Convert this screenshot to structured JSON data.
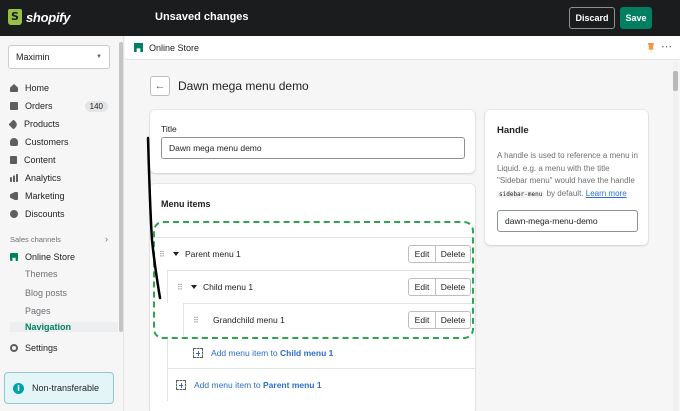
{
  "topbar": {
    "brand": "shopify",
    "status": "Unsaved changes",
    "discard_label": "Discard",
    "save_label": "Save"
  },
  "sidebar": {
    "store_name": "Maximin",
    "items": [
      {
        "label": "Home",
        "icon": "home-icon"
      },
      {
        "label": "Orders",
        "icon": "orders-icon",
        "badge": "140"
      },
      {
        "label": "Products",
        "icon": "tag-icon"
      },
      {
        "label": "Customers",
        "icon": "person-icon"
      },
      {
        "label": "Content",
        "icon": "content-icon"
      },
      {
        "label": "Analytics",
        "icon": "analytics-icon"
      },
      {
        "label": "Marketing",
        "icon": "megaphone-icon"
      },
      {
        "label": "Discounts",
        "icon": "discount-icon"
      }
    ],
    "sales_channels_label": "Sales channels",
    "online_store": "Online Store",
    "sub_items": [
      "Themes",
      "Blog posts",
      "Pages",
      "Navigation"
    ],
    "settings": "Settings",
    "non_transferable": "Non-transferable"
  },
  "app_bar": {
    "title": "Online Store"
  },
  "page": {
    "title": "Dawn mega menu demo"
  },
  "title_card": {
    "label": "Title",
    "value": "Dawn mega menu demo"
  },
  "menu_card": {
    "heading": "Menu items",
    "items": [
      {
        "label": "Parent menu 1"
      },
      {
        "label": "Child menu 1"
      },
      {
        "label": "Grandchild menu 1"
      }
    ],
    "edit_label": "Edit",
    "delete_label": "Delete",
    "add_child_prefix": "Add menu item to",
    "add_child_target": "Child menu 1",
    "add_parent_prefix": "Add menu item to",
    "add_parent_target": "Parent menu 1"
  },
  "handle_card": {
    "title": "Handle",
    "help_1": "A handle is used to reference a menu in Liquid. e.g. a menu with the title \"Sidebar menu\" would have the handle",
    "help_code": "sidebar-menu",
    "help_2": "by default.",
    "learn_more": "Learn more",
    "value": "dawn-mega-menu-demo"
  },
  "colors": {
    "topbar": "#1a1c1d",
    "save": "#008060",
    "annotation_dash": "#2ea44f",
    "link": "#2c6ecb"
  }
}
